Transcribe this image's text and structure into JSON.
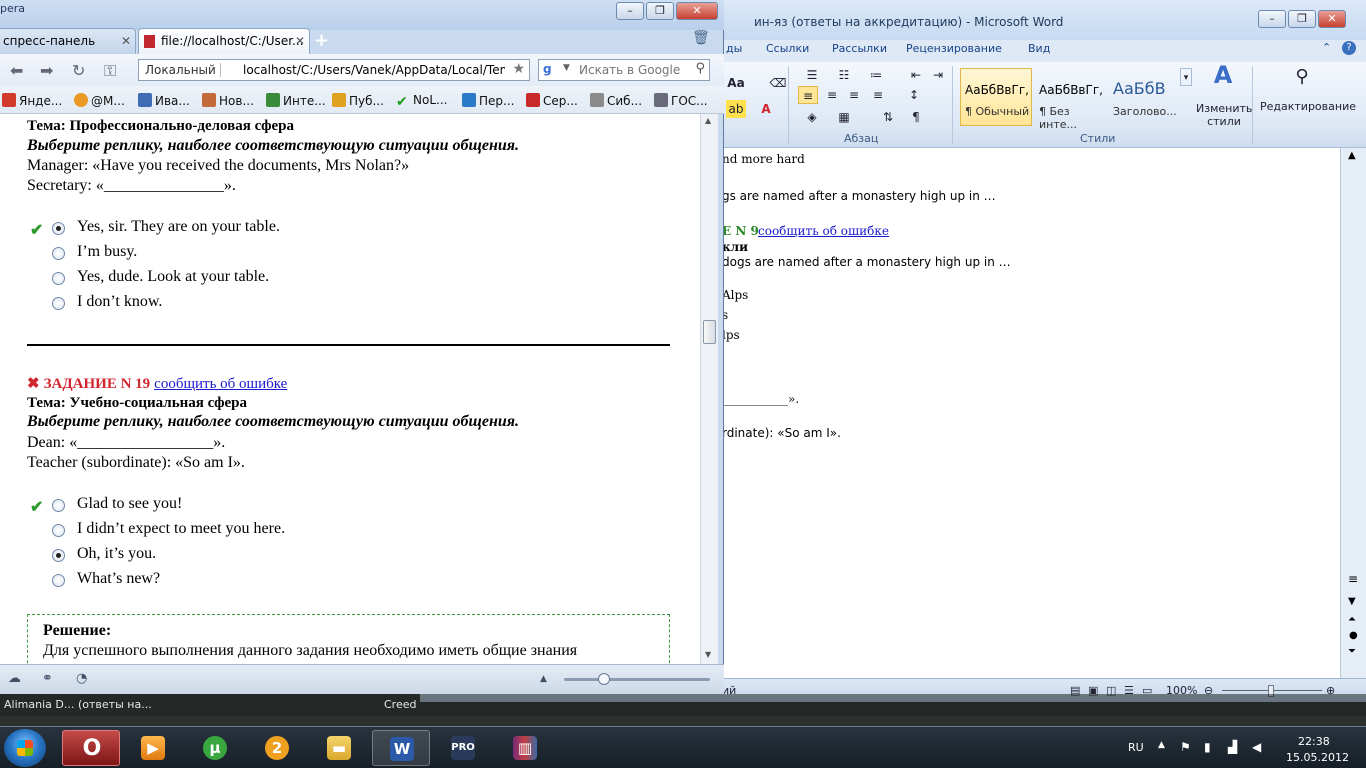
{
  "word": {
    "title": "ин-яз (ответы на аккредитацию)  -  Microsoft Word",
    "tabs": [
      "ды",
      "Ссылки",
      "Рассылки",
      "Рецензирование",
      "Вид"
    ],
    "ribbon": {
      "group_paragraph": "Абзац",
      "group_styles": "Стили",
      "styles": [
        {
          "preview": "АаБбВвГг,",
          "name": "¶ Обычный"
        },
        {
          "preview": "АаБбВвГг,",
          "name": "¶ Без инте..."
        },
        {
          "preview": "АаБбВ",
          "name": "Заголово..."
        }
      ],
      "change_styles": "Изменить стили",
      "editing": "Редактирование",
      "aa_label": "Aa"
    },
    "doc_lines": [
      "nd more hard",
      "gs are named after a monastery high up in …",
      "E N 9",
      "сообщить об ошибке",
      "кли",
      "dogs are named after a monastery high up in …",
      "Alps",
      "s",
      "lps",
      "___________».",
      "rdinate): «So am I»."
    ],
    "status": {
      "left": "ий",
      "zoom": "100%"
    }
  },
  "browser": {
    "brand": "pera",
    "tabs": [
      {
        "label": "спресс-панель"
      },
      {
        "label": "file://localhost/C:/User..."
      }
    ],
    "address": {
      "scheme_label": "Локальный",
      "url": "localhost/C:/Users/Vanek/AppData/Local/Temp/I"
    },
    "search_placeholder": "Искать в Google",
    "bookmarks": [
      "Янде...",
      "@M...",
      "Ива...",
      "Нов...",
      "Инте...",
      "Пуб...",
      "NoL...",
      "Пер...",
      "Сер...",
      "Сиб...",
      "ГОС..."
    ],
    "content": {
      "q18": {
        "theme": "Тема: Профессионально-деловая сфера",
        "instruction": "Выберите реплику, наиболее соответствующую ситуации общения.",
        "line1": "Manager: «Have you received the documents, Mrs Nolan?»",
        "line2": "Secretary: «_______________».",
        "options": [
          {
            "text": "Yes, sir. They are on your table.",
            "selected": true,
            "correct": true
          },
          {
            "text": "I’m busy.",
            "selected": false,
            "correct": false
          },
          {
            "text": "Yes, dude. Look at your table.",
            "selected": false,
            "correct": false
          },
          {
            "text": "I don’t know.",
            "selected": false,
            "correct": false
          }
        ]
      },
      "q19": {
        "title": "ЗАДАНИЕ N 19",
        "report": "сообщить об ошибке",
        "theme": "Тема: Учебно-социальная сфера",
        "instruction": "Выберите реплику, наиболее соответствующую ситуации общения.",
        "line1": "Dean: «_________________».",
        "line2": "Teacher (subordinate): «So am I».",
        "options": [
          {
            "text": "Glad to see you!",
            "selected": false,
            "correct": true
          },
          {
            "text": "I didn’t expect to meet you here.",
            "selected": false,
            "correct": false
          },
          {
            "text": "Oh, it’s you.",
            "selected": true,
            "correct": false
          },
          {
            "text": "What’s new?",
            "selected": false,
            "correct": false
          }
        ],
        "solution_title": "Решение:",
        "solution_text": "Для успешного выполнения данного задания необходимо иметь общие знания"
      }
    }
  },
  "taskbar": {
    "previews": [
      "Alimania D...",
      "(ответы на...",
      "Creed"
    ],
    "language": "RU",
    "time": "22:38",
    "date": "15.05.2012"
  }
}
